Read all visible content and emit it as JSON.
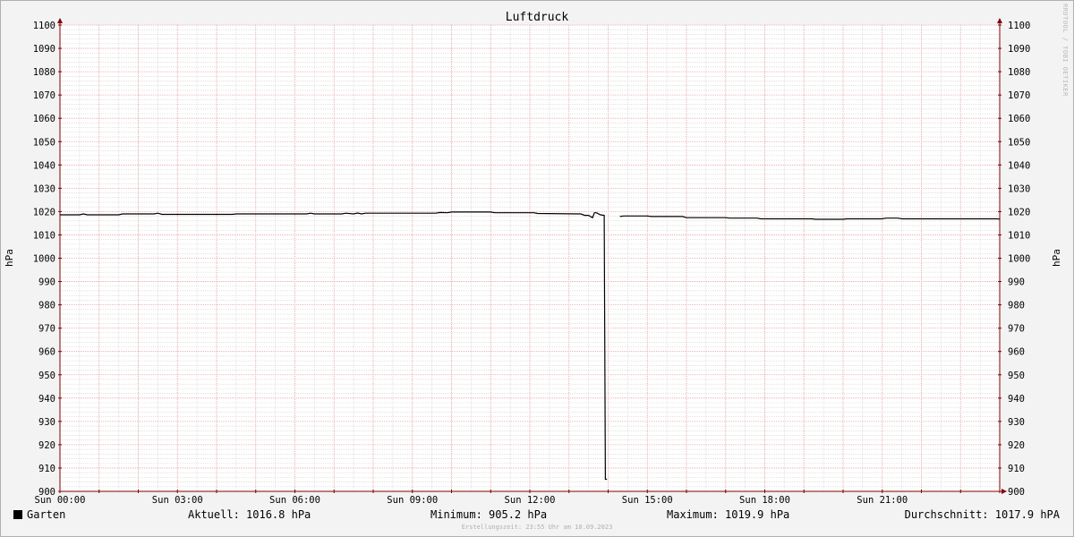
{
  "chart_data": {
    "type": "line",
    "title": "Luftdruck",
    "ylabel_left": "hPa",
    "ylabel_right": "hPa",
    "ylim": [
      900,
      1100
    ],
    "xlim_hours": [
      0,
      24
    ],
    "y_ticks": [
      900,
      910,
      920,
      930,
      940,
      950,
      960,
      970,
      980,
      990,
      1000,
      1010,
      1020,
      1030,
      1040,
      1050,
      1060,
      1070,
      1080,
      1090,
      1100
    ],
    "x_ticks": [
      {
        "hour": 0,
        "label": "Sun 00:00"
      },
      {
        "hour": 3,
        "label": "Sun 03:00"
      },
      {
        "hour": 6,
        "label": "Sun 06:00"
      },
      {
        "hour": 9,
        "label": "Sun 09:00"
      },
      {
        "hour": 12,
        "label": "Sun 12:00"
      },
      {
        "hour": 15,
        "label": "Sun 15:00"
      },
      {
        "hour": 18,
        "label": "Sun 18:00"
      },
      {
        "hour": 21,
        "label": "Sun 21:00"
      }
    ],
    "grid": true,
    "series": [
      {
        "name": "Garten",
        "color": "#000000",
        "segments": [
          [
            [
              0.0,
              1018.6
            ],
            [
              0.5,
              1018.6
            ],
            [
              0.6,
              1019.0
            ],
            [
              0.7,
              1018.6
            ],
            [
              1.5,
              1018.6
            ],
            [
              1.6,
              1019.0
            ],
            [
              2.4,
              1019.0
            ],
            [
              2.5,
              1019.3
            ],
            [
              2.6,
              1018.8
            ],
            [
              4.4,
              1018.8
            ],
            [
              4.5,
              1019.0
            ],
            [
              6.3,
              1019.0
            ],
            [
              6.4,
              1019.3
            ],
            [
              6.5,
              1019.0
            ],
            [
              7.2,
              1019.0
            ],
            [
              7.3,
              1019.3
            ],
            [
              7.5,
              1019.0
            ],
            [
              7.6,
              1019.4
            ],
            [
              7.7,
              1019.0
            ],
            [
              7.8,
              1019.3
            ],
            [
              9.6,
              1019.3
            ],
            [
              9.7,
              1019.6
            ],
            [
              9.9,
              1019.5
            ],
            [
              10.0,
              1019.8
            ],
            [
              11.0,
              1019.8
            ],
            [
              11.1,
              1019.5
            ],
            [
              12.1,
              1019.5
            ],
            [
              12.2,
              1019.2
            ],
            [
              13.3,
              1019.0
            ],
            [
              13.4,
              1018.4
            ],
            [
              13.5,
              1018.4
            ],
            [
              13.6,
              1017.4
            ],
            [
              13.65,
              1019.5
            ],
            [
              13.7,
              1019.5
            ],
            [
              13.8,
              1018.6
            ],
            [
              13.9,
              1018.4
            ],
            [
              13.93,
              905.2
            ],
            [
              13.97,
              905.2
            ]
          ],
          [
            [
              14.3,
              1017.9
            ],
            [
              14.4,
              1018.1
            ],
            [
              15.0,
              1018.1
            ],
            [
              15.1,
              1017.9
            ],
            [
              15.9,
              1017.9
            ],
            [
              16.0,
              1017.4
            ],
            [
              17.0,
              1017.4
            ],
            [
              17.1,
              1017.2
            ],
            [
              17.8,
              1017.2
            ],
            [
              17.9,
              1016.9
            ],
            [
              19.2,
              1016.9
            ],
            [
              19.3,
              1016.7
            ],
            [
              20.0,
              1016.7
            ],
            [
              20.1,
              1016.9
            ],
            [
              21.0,
              1016.9
            ],
            [
              21.1,
              1017.2
            ],
            [
              21.4,
              1017.2
            ],
            [
              21.5,
              1016.9
            ],
            [
              23.9,
              1016.9
            ],
            [
              24.0,
              1016.8
            ]
          ]
        ]
      }
    ]
  },
  "legend": {
    "series_name": "Garten",
    "current": "Aktuell: 1016.8 hPa",
    "minimum": "Minimum: 905.2 hPa",
    "maximum": "Maximum: 1019.9 hPa",
    "average": "Durchschnitt: 1017.9 hPA"
  },
  "footer": "Erstellungszeit: 23:55 Uhr am 10.09.2023",
  "watermark": "RRDTOOL / TOBI OETIKER",
  "colors": {
    "background": "#f3f3f3",
    "canvas": "#ffffff",
    "major_grid": "#e8a0a0",
    "minor_grid": "#d0d0d0",
    "axis": "#800000",
    "line": "#000000"
  }
}
